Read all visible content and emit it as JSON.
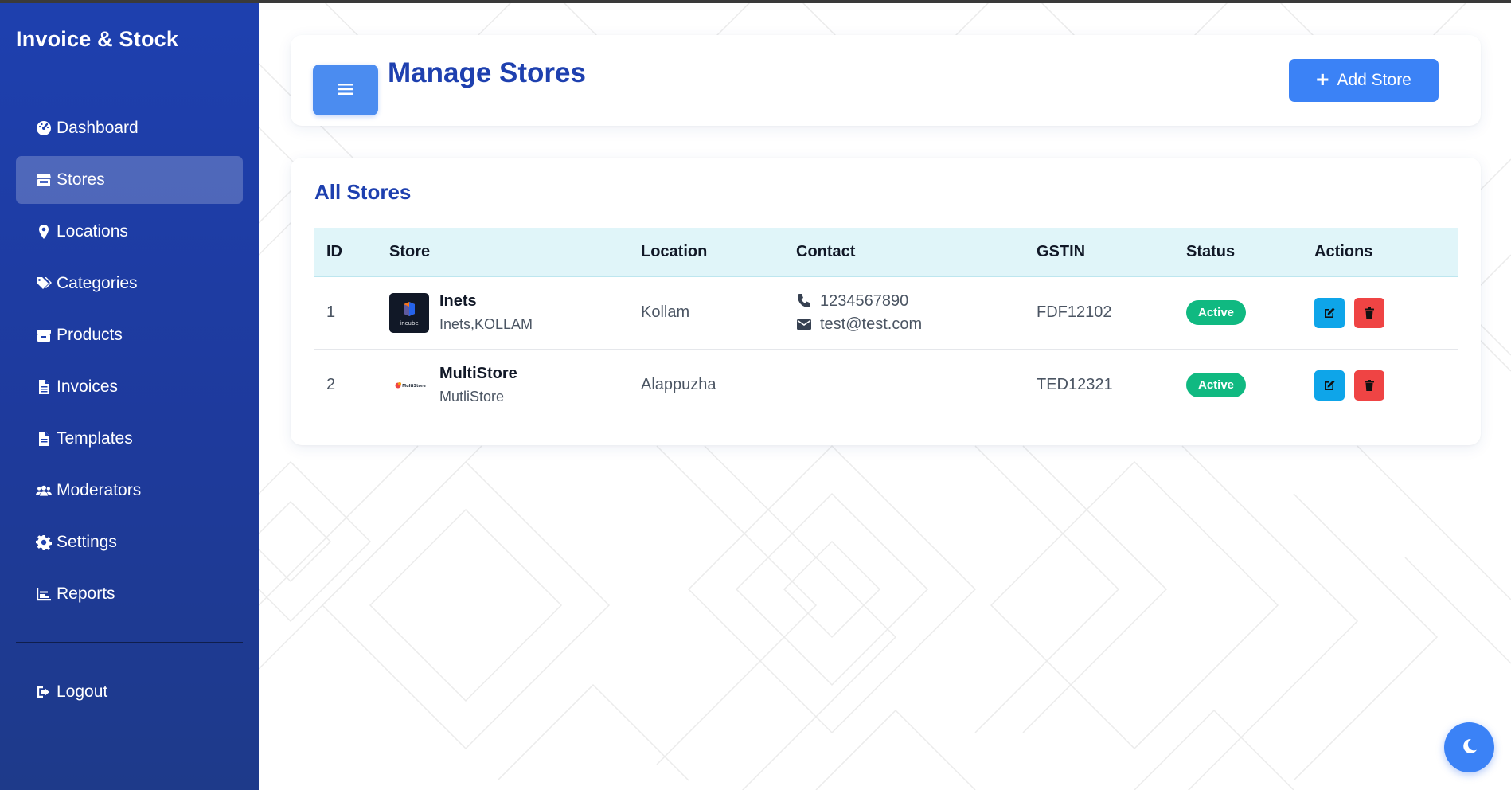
{
  "app": {
    "brand": "Invoice & Stock"
  },
  "sidebar": {
    "items": [
      {
        "label": "Dashboard",
        "icon": "gauge-icon"
      },
      {
        "label": "Stores",
        "icon": "store-icon",
        "active": true
      },
      {
        "label": "Locations",
        "icon": "map-pin-icon"
      },
      {
        "label": "Categories",
        "icon": "tags-icon"
      },
      {
        "label": "Products",
        "icon": "box-icon"
      },
      {
        "label": "Invoices",
        "icon": "invoice-file-icon"
      },
      {
        "label": "Templates",
        "icon": "template-file-icon"
      },
      {
        "label": "Moderators",
        "icon": "users-icon"
      },
      {
        "label": "Settings",
        "icon": "gear-icon"
      },
      {
        "label": "Reports",
        "icon": "chart-icon"
      }
    ],
    "logout": {
      "label": "Logout",
      "icon": "sign-out-icon"
    }
  },
  "header": {
    "menu_icon": "hamburger-icon",
    "title": "Manage Stores",
    "add_button": "Add Store"
  },
  "stores": {
    "section_title": "All Stores",
    "columns": [
      "ID",
      "Store",
      "Location",
      "Contact",
      "GSTIN",
      "Status",
      "Actions"
    ],
    "rows": [
      {
        "id": "1",
        "name": "Inets",
        "sub": "Inets,KOLLAM",
        "location": "Kollam",
        "phone": "1234567890",
        "email": "test@test.com",
        "gstin": "FDF12102",
        "status": "Active",
        "logo_text": "incube"
      },
      {
        "id": "2",
        "name": "MultiStore",
        "sub": "MutliStore",
        "location": "Alappuzha",
        "phone": "",
        "email": "",
        "gstin": "TED12321",
        "status": "Active",
        "logo_text": "MultiStore"
      }
    ]
  },
  "theme_toggle": {
    "icon": "moon-icon"
  },
  "colors": {
    "sidebar": "#1e40af",
    "accent": "#3b82f6",
    "title": "#1e40af",
    "active_badge": "#10b981",
    "edit": "#0ea5e9",
    "delete": "#ef4444",
    "table_header": "#e0f5f9"
  }
}
